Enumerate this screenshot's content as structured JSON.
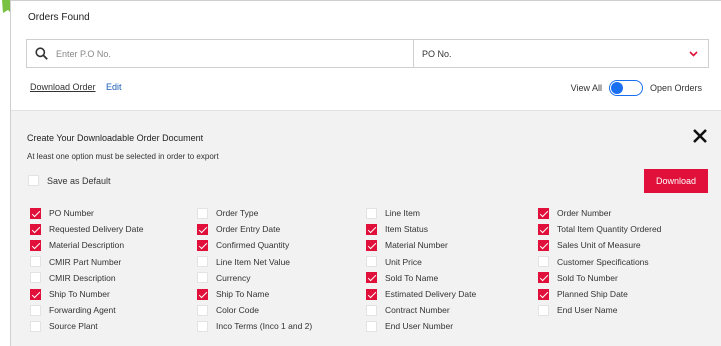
{
  "header": {
    "title": "Orders Found"
  },
  "search": {
    "placeholder": "Enter P.O No.",
    "type_value": "PO No."
  },
  "links": {
    "download_order": "Download Order",
    "edit": "Edit"
  },
  "view_toggle": {
    "left_label": "View All",
    "right_label": "Open Orders"
  },
  "panel": {
    "title": "Create Your Downloadable Order Document",
    "note": "At least one option must be selected in order to export",
    "save_default_label": "Save as Default",
    "save_default_checked": false,
    "download_label": "Download",
    "columns": [
      [
        {
          "label": "PO Number",
          "checked": true
        },
        {
          "label": "Requested Delivery Date",
          "checked": true
        },
        {
          "label": "Material Description",
          "checked": true
        },
        {
          "label": "CMIR Part Number",
          "checked": false
        },
        {
          "label": "CMIR Description",
          "checked": false
        },
        {
          "label": "Ship To Number",
          "checked": true
        },
        {
          "label": "Forwarding Agent",
          "checked": false
        },
        {
          "label": "Source Plant",
          "checked": false
        }
      ],
      [
        {
          "label": "Order Type",
          "checked": false
        },
        {
          "label": "Order Entry Date",
          "checked": true
        },
        {
          "label": "Confirmed Quantity",
          "checked": true
        },
        {
          "label": "Line Item Net Value",
          "checked": false
        },
        {
          "label": "Currency",
          "checked": false
        },
        {
          "label": "Ship To Name",
          "checked": true
        },
        {
          "label": "Color Code",
          "checked": false
        },
        {
          "label": "Inco Terms (Inco 1 and 2)",
          "checked": false
        }
      ],
      [
        {
          "label": "Line Item",
          "checked": false
        },
        {
          "label": "Item Status",
          "checked": true
        },
        {
          "label": "Material Number",
          "checked": true
        },
        {
          "label": "Unit Price",
          "checked": false
        },
        {
          "label": "Sold To Name",
          "checked": true
        },
        {
          "label": "Estimated Delivery Date",
          "checked": true
        },
        {
          "label": "Contract Number",
          "checked": false
        },
        {
          "label": "End User Number",
          "checked": false
        }
      ],
      [
        {
          "label": "Order Number",
          "checked": true
        },
        {
          "label": "Total Item Quantity Ordered",
          "checked": true
        },
        {
          "label": "Sales Unit of Measure",
          "checked": true
        },
        {
          "label": "Customer Specifications",
          "checked": false
        },
        {
          "label": "Sold To Number",
          "checked": true
        },
        {
          "label": "Planned Ship Date",
          "checked": true
        },
        {
          "label": "End User Name",
          "checked": false
        }
      ]
    ]
  },
  "colors": {
    "accent_red": "#e0103a",
    "toggle_blue": "#1a6ff0",
    "arrow_green": "#7ac142"
  }
}
